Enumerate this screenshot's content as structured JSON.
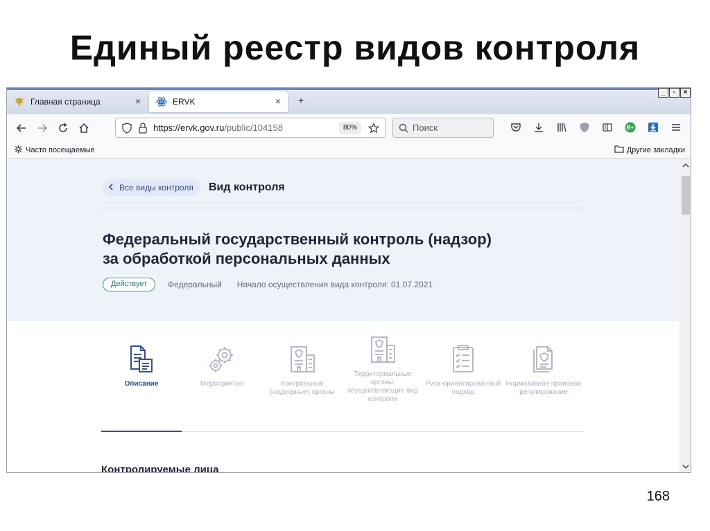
{
  "slide": {
    "title": "Единый реестр видов контроля",
    "page_number": "168"
  },
  "browser": {
    "tabs": [
      {
        "label": "Главная страница",
        "icon": "emblem-icon",
        "close": "×"
      },
      {
        "label": "ERVK",
        "icon": "atom-icon",
        "close": "×"
      }
    ],
    "new_tab": "+",
    "window_controls": [
      "_",
      "▫",
      "×"
    ],
    "url_host": "https://ervk.gov.ru",
    "url_path": "/public/104158",
    "zoom": "80%",
    "search_placeholder": "Поиск",
    "bookmarks_left": "Часто посещаемые",
    "bookmarks_right": "Другие закладки",
    "toolbar_icons": [
      "pocket-icon",
      "download-icon",
      "library-icon",
      "shield-icon",
      "reader-icon",
      "extension-icon",
      "download-helper-icon",
      "menu-icon"
    ],
    "extension_badge": "B+"
  },
  "page": {
    "back_link": "Все виды контроля",
    "section_title": "Вид контроля",
    "heading_line1": "Федеральный государственный контроль (надзор)",
    "heading_line2": "за обработкой персональных данных",
    "status": "Действует",
    "level": "Федеральный",
    "start_date": "Начало осуществления вида контроля: 01.07.2021",
    "tabs": [
      {
        "label": "Описание",
        "icon": "document-icon",
        "active": true
      },
      {
        "label": "Мероприятия",
        "icon": "gear-icon",
        "active": false
      },
      {
        "label": "Контрольные (надзорные) органы",
        "icon": "government-building-icon",
        "active": false
      },
      {
        "label": "Территориальные органы, осуществляющие вид контроля",
        "icon": "territorial-building-icon",
        "active": false
      },
      {
        "label": "Риск-ориентированный подход",
        "icon": "checklist-icon",
        "active": false
      },
      {
        "label": "Нормативное правовое регулирование",
        "icon": "regulation-document-icon",
        "active": false
      }
    ],
    "controlled_persons_heading": "Контролируемые лица"
  },
  "colors": {
    "accent": "#34518f",
    "status_green": "#3aa37b",
    "hero_bg": "#eef2f9",
    "inactive_tab": "#aab3c4"
  }
}
